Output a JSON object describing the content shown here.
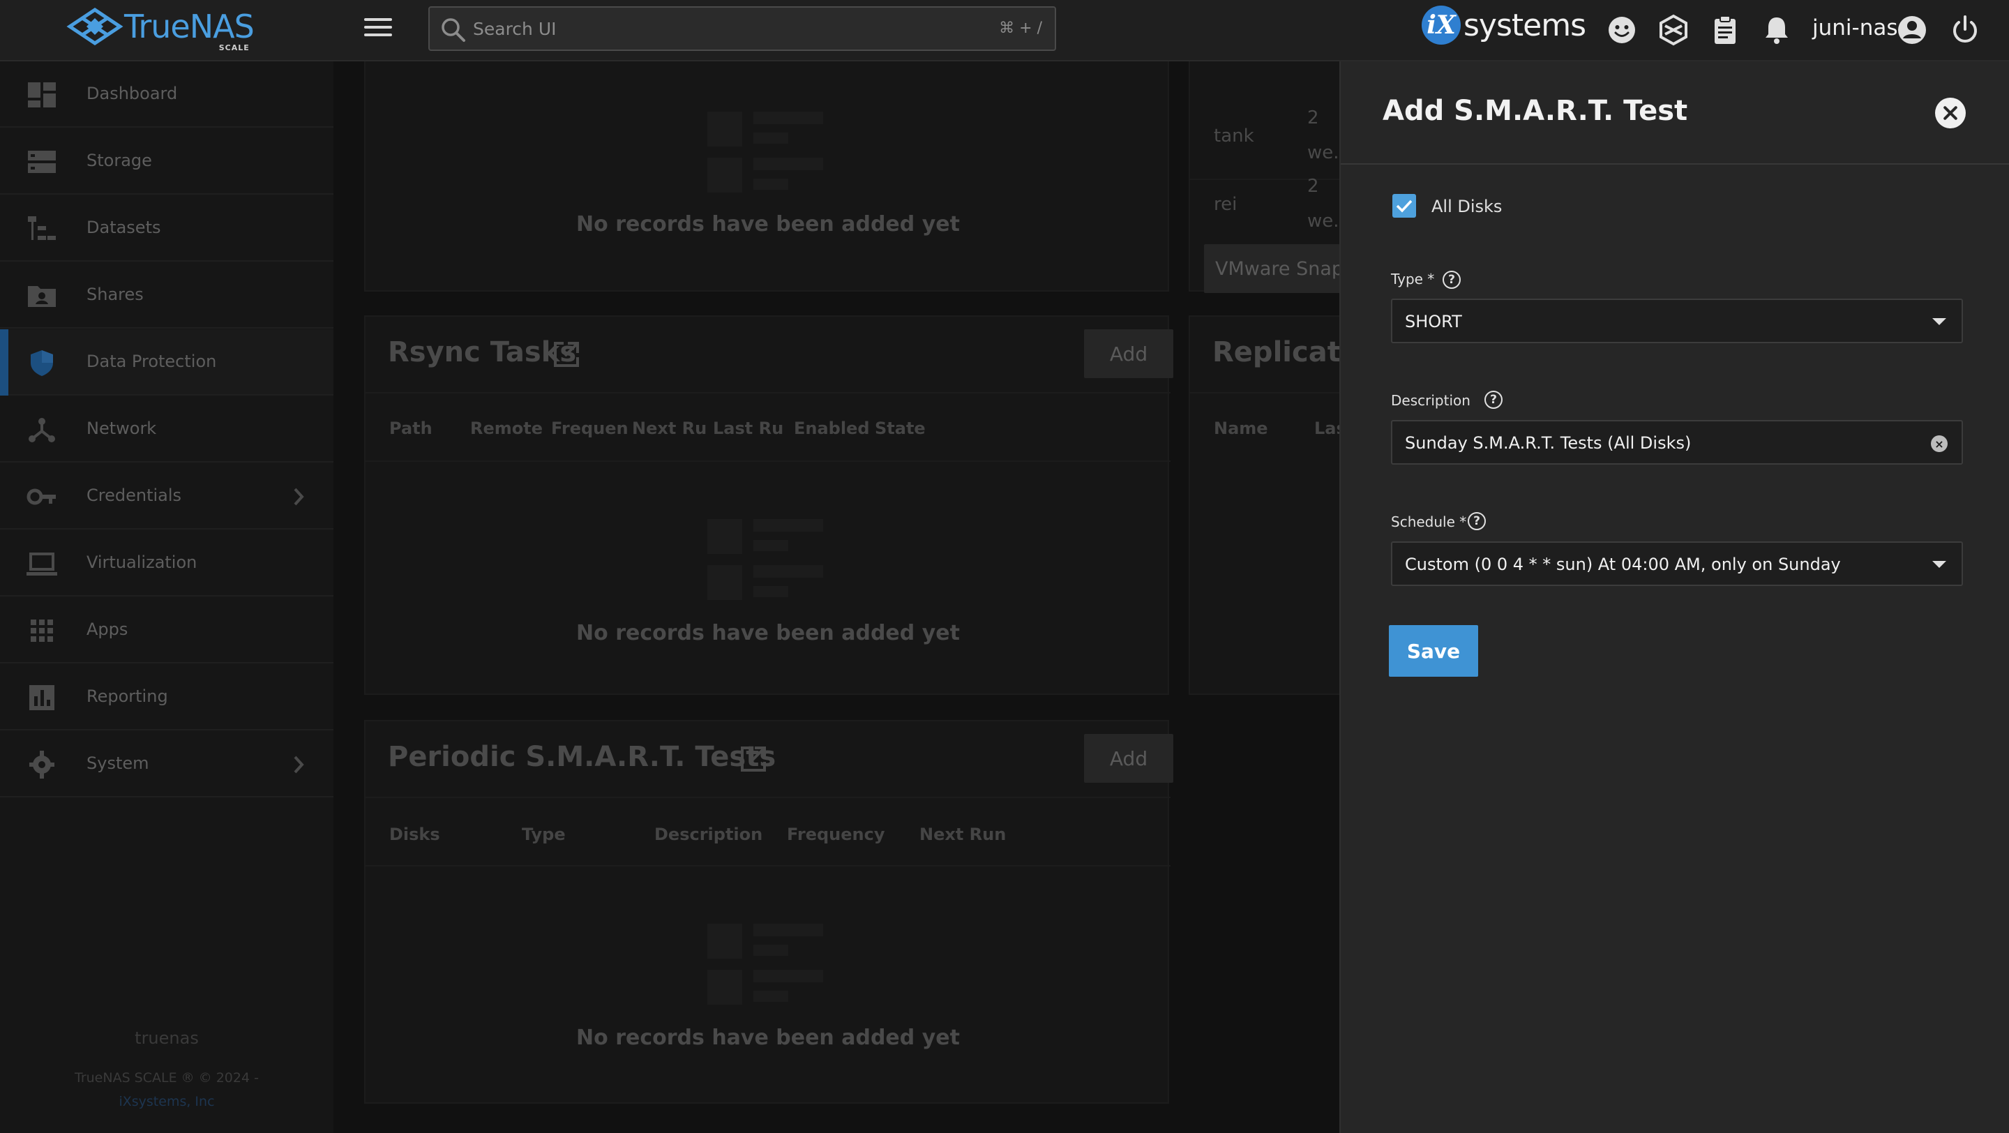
{
  "header": {
    "logo_text": "TrueNAS",
    "logo_sub": "SCALE",
    "search_placeholder": "Search UI",
    "search_shortcut": "⌘ + /",
    "brand_mark": "iX",
    "brand_text": "systems",
    "hostname": "juni-nas"
  },
  "sidebar": {
    "items": [
      {
        "label": "Dashboard",
        "icon": "dashboard-icon"
      },
      {
        "label": "Storage",
        "icon": "storage-icon"
      },
      {
        "label": "Datasets",
        "icon": "datasets-icon"
      },
      {
        "label": "Shares",
        "icon": "shares-icon"
      },
      {
        "label": "Data Protection",
        "icon": "shield-icon",
        "active": true
      },
      {
        "label": "Network",
        "icon": "network-icon"
      },
      {
        "label": "Credentials",
        "icon": "key-icon",
        "has_children": true
      },
      {
        "label": "Virtualization",
        "icon": "laptop-icon"
      },
      {
        "label": "Apps",
        "icon": "apps-grid-icon"
      },
      {
        "label": "Reporting",
        "icon": "bar-chart-icon"
      },
      {
        "label": "System",
        "icon": "gear-icon",
        "has_children": true
      }
    ],
    "footer_host": "truenas",
    "footer_copyright": "TrueNAS SCALE ® © 2024 -",
    "footer_link": "iXsystems, Inc"
  },
  "main": {
    "top_card": {
      "empty_text": "No records have been added yet"
    },
    "rsync": {
      "title": "Rsync Tasks",
      "add_label": "Add",
      "columns": [
        "Path",
        "Remote",
        "Frequen",
        "Next Ru",
        "Last Ru",
        "Enabled",
        "State"
      ],
      "empty_text": "No records have been added yet"
    },
    "smart": {
      "title": "Periodic S.M.A.R.T. Tests",
      "add_label": "Add",
      "columns": [
        "Disks",
        "Type",
        "Description",
        "Frequency",
        "Next Run"
      ],
      "empty_text": "No records have been added yet"
    },
    "right_card": {
      "rows": [
        {
          "name": "tank",
          "val1": "2",
          "val2": "we..."
        },
        {
          "name": "rei",
          "val1": "2",
          "val2": "we..."
        }
      ],
      "vmware_button": "VMware Snap",
      "replication_title": "Replicatio",
      "columns": [
        "Name",
        "Las"
      ]
    }
  },
  "panel": {
    "title": "Add S.M.A.R.T. Test",
    "all_disks_label": "All Disks",
    "all_disks_checked": true,
    "type_label": "Type *",
    "type_value": "SHORT",
    "description_label": "Description",
    "description_value": "Sunday S.M.A.R.T. Tests (All Disks)",
    "schedule_label": "Schedule *",
    "schedule_value": "Custom (0 0 4 * * sun) At 04:00 AM, only on Sunday",
    "save_label": "Save"
  },
  "colors": {
    "accent": "#3f93d4",
    "logo_blue": "#4a9ee0",
    "panel_bg": "#262626"
  }
}
